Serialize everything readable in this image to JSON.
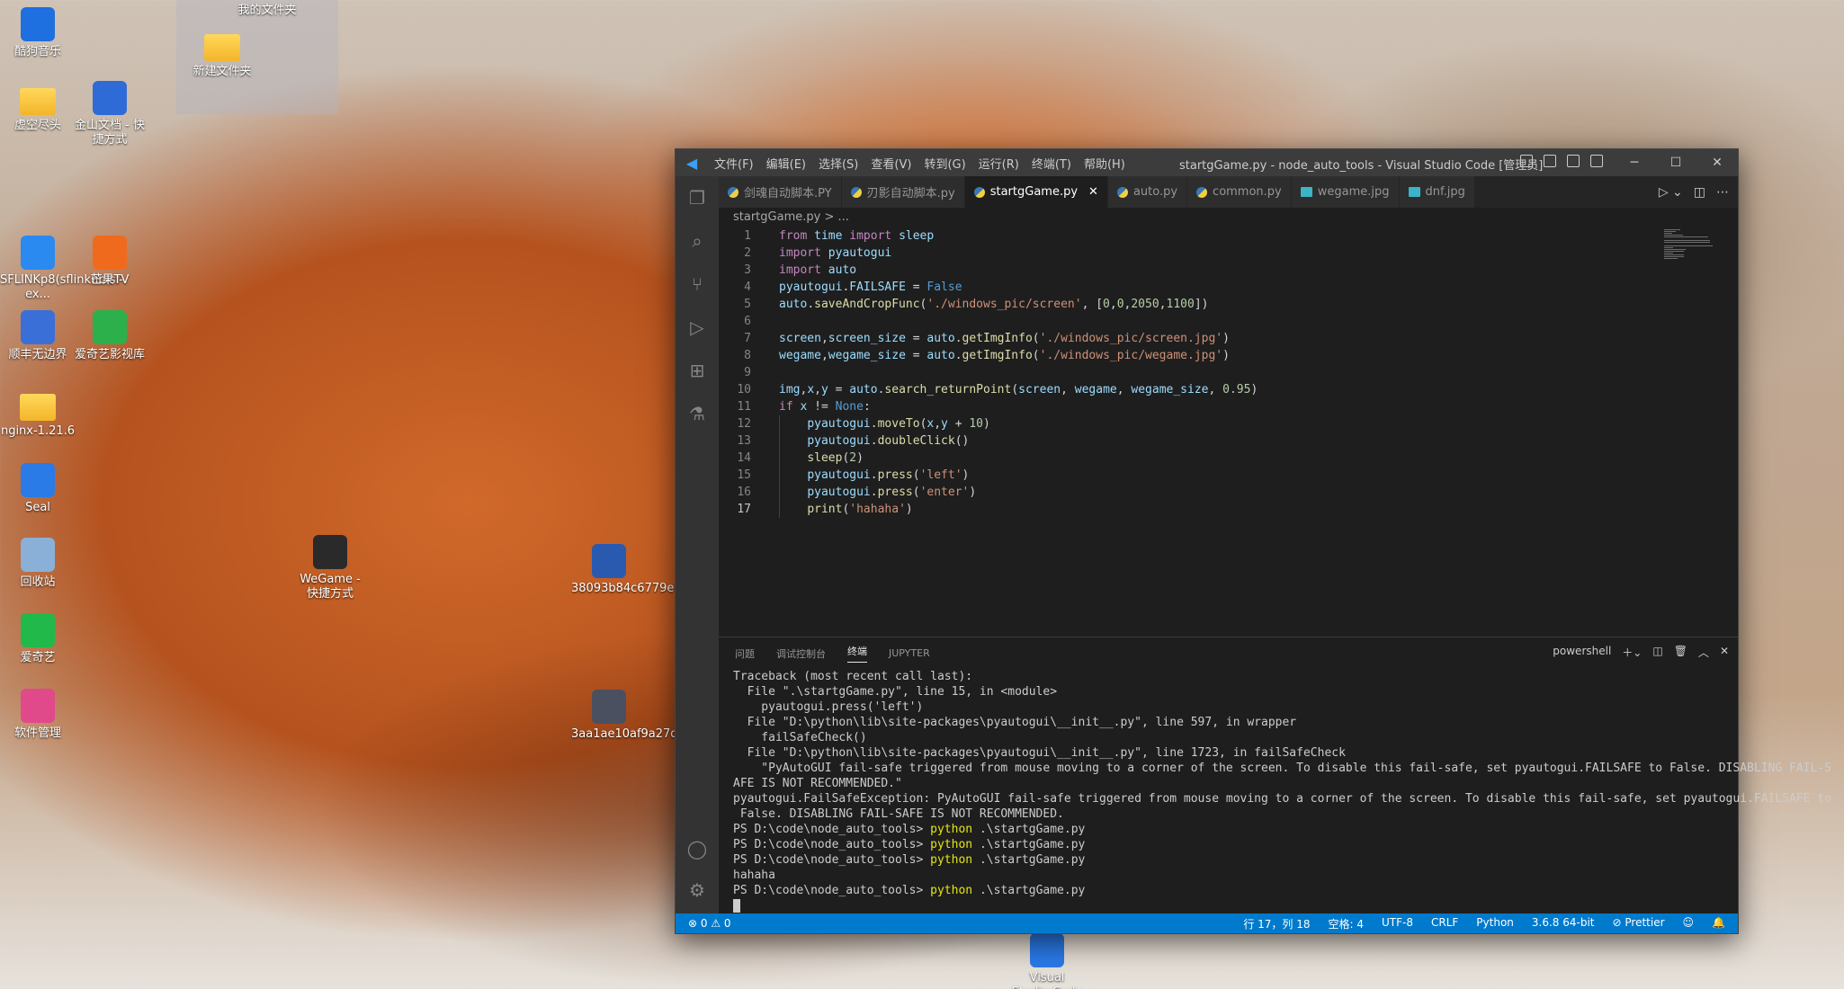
{
  "desktop": {
    "icons": [
      {
        "label": "酷狗音乐",
        "color": "#1e6fe0"
      },
      {
        "label": "虚空尽头",
        "color": "folder"
      },
      {
        "label": "金山文档 - 快捷方式",
        "color": "#2f6bd6"
      },
      {
        "label": "我的文件夹",
        "color": "folder"
      },
      {
        "label": "新建文件夹",
        "color": "folder"
      },
      {
        "label": "SFLINKp8(sflinkhb.sf-ex...",
        "color": "#2a8af0"
      },
      {
        "label": "芒果TV",
        "color": "#f06a1e"
      },
      {
        "label": "顺丰无边界",
        "color": "#3a6fd8"
      },
      {
        "label": "爱奇艺影视库",
        "color": "#2bb04c"
      },
      {
        "label": "nginx-1.21.6",
        "color": "folder"
      },
      {
        "label": "Seal",
        "color": "#2a7ae8"
      },
      {
        "label": "回收站",
        "color": "#8ab0d8"
      },
      {
        "label": "爱奇艺",
        "color": "#21b94a"
      },
      {
        "label": "软件管理",
        "color": "#e04a8a"
      },
      {
        "label": "WeGame - 快捷方式",
        "color": "#2a2a2a"
      },
      {
        "label": "38093b84c6779e69ab9...",
        "color": "#2a5ab0"
      },
      {
        "label": "3aa1ae10af9a27d7e4e4...",
        "color": "#4a5060"
      },
      {
        "label": "Visual Studio Code",
        "color": "#2a7ae8"
      }
    ]
  },
  "vscode": {
    "menu": [
      "文件(F)",
      "编辑(E)",
      "选择(S)",
      "查看(V)",
      "转到(G)",
      "运行(R)",
      "终端(T)",
      "帮助(H)"
    ],
    "window_title": "startgGame.py - node_auto_tools - Visual Studio Code [管理员]",
    "tabs": [
      {
        "label": "剑魂自动脚本.PY",
        "type": "py"
      },
      {
        "label": "刃影自动脚本.py",
        "type": "py"
      },
      {
        "label": "startgGame.py",
        "type": "py",
        "active": true
      },
      {
        "label": "auto.py",
        "type": "py"
      },
      {
        "label": "common.py",
        "type": "py"
      },
      {
        "label": "wegame.jpg",
        "type": "img"
      },
      {
        "label": "dnf.jpg",
        "type": "img"
      }
    ],
    "breadcrumb": "startgGame.py > ...",
    "code_lines": [
      "from time import sleep",
      "import pyautogui",
      "import auto",
      "pyautogui.FAILSAFE = False",
      "auto.saveAndCropFunc('./windows_pic/screen', [0,0,2050,1100])",
      "",
      "screen,screen_size = auto.getImgInfo('./windows_pic/screen.jpg')",
      "wegame,wegame_size = auto.getImgInfo('./windows_pic/wegame.jpg')",
      "",
      "img,x,y = auto.search_returnPoint(screen, wegame, wegame_size, 0.95)",
      "if x != None:",
      "    pyautogui.moveTo(x,y + 10)",
      "    pyautogui.doubleClick()",
      "    sleep(2)",
      "    pyautogui.press('left')",
      "    pyautogui.press('enter')",
      "    print('hahaha')"
    ],
    "current_line": 17,
    "panel_tabs": [
      "问题",
      "调试控制台",
      "终端",
      "JUPYTER"
    ],
    "active_panel_tab": "终端",
    "shell_label": "powershell",
    "terminal_lines": [
      "Traceback (most recent call last):",
      "  File \".\\startgGame.py\", line 15, in <module>",
      "    pyautogui.press('left')",
      "  File \"D:\\python\\lib\\site-packages\\pyautogui\\__init__.py\", line 597, in wrapper",
      "    failSafeCheck()",
      "  File \"D:\\python\\lib\\site-packages\\pyautogui\\__init__.py\", line 1723, in failSafeCheck",
      "    \"PyAutoGUI fail-safe triggered from mouse moving to a corner of the screen. To disable this fail-safe, set pyautogui.FAILSAFE to False. DISABLING FAIL-S",
      "AFE IS NOT RECOMMENDED.\"",
      "pyautogui.FailSafeException: PyAutoGUI fail-safe triggered from mouse moving to a corner of the screen. To disable this fail-safe, set pyautogui.FAILSAFE to",
      " False. DISABLING FAIL-SAFE IS NOT RECOMMENDED."
    ],
    "prompt_lines": [
      {
        "prompt": "PS D:\\code\\node_auto_tools> ",
        "cmd": "python",
        "args": " .\\startgGame.py"
      },
      {
        "prompt": "PS D:\\code\\node_auto_tools> ",
        "cmd": "python",
        "args": " .\\startgGame.py"
      },
      {
        "prompt": "PS D:\\code\\node_auto_tools> ",
        "cmd": "python",
        "args": " .\\startgGame.py"
      },
      {
        "output": "hahaha"
      },
      {
        "prompt": "PS D:\\code\\node_auto_tools> ",
        "cmd": "python",
        "args": " .\\startgGame.py"
      }
    ],
    "status": {
      "problems": "⊗ 0 ⚠ 0",
      "position": "行 17，列 18",
      "spaces": "空格: 4",
      "encoding": "UTF-8",
      "eol": "CRLF",
      "language": "Python",
      "interpreter": "3.6.8 64-bit",
      "prettier": "⊘ Prettier"
    }
  }
}
